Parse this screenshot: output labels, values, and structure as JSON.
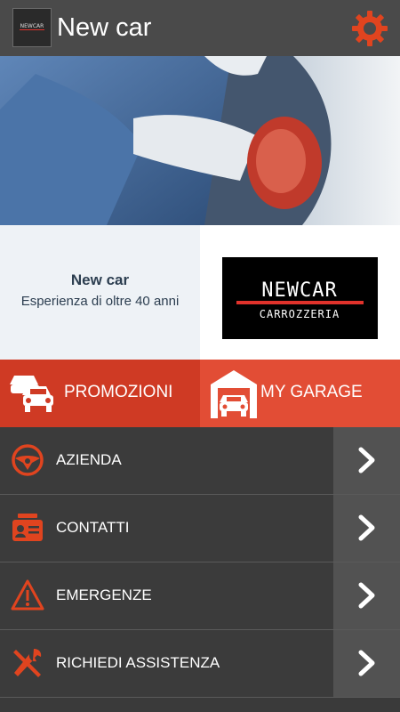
{
  "header": {
    "title": "New car",
    "settings_icon": "gear-icon",
    "logo_icon": "newcar-logo"
  },
  "hero": {
    "image": "car-polishing-photo"
  },
  "info": {
    "title": "New car",
    "subtitle": "Esperienza di oltre 40 anni"
  },
  "brand": {
    "line1": "NEWCAR",
    "line2": "CARROZZERIA",
    "accent": "#e0322b"
  },
  "tiles": [
    {
      "label": "PROMOZIONI",
      "icon": "cars-icon",
      "color": "#cf3a24"
    },
    {
      "label": "MY GARAGE",
      "icon": "garage-icon",
      "color": "#e24d35"
    }
  ],
  "menu": [
    {
      "label": "AZIENDA",
      "icon": "steering-wheel-icon"
    },
    {
      "label": "CONTATTI",
      "icon": "contact-card-icon"
    },
    {
      "label": "EMERGENZE",
      "icon": "warning-icon"
    },
    {
      "label": "RICHIEDI ASSISTENZA",
      "icon": "tools-icon"
    }
  ],
  "colors": {
    "topbar": "#4a4a4a",
    "accent": "#e24d35",
    "menu_bg": "#3b3b3b",
    "arrow_bg": "#525252"
  }
}
